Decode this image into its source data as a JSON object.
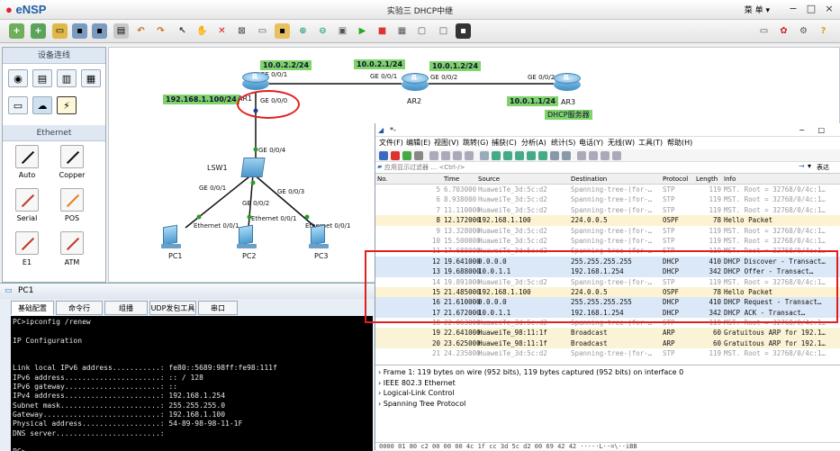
{
  "app": {
    "name": "eNSP",
    "window_title": "实验三 DHCP中继",
    "menu_label": "菜 单"
  },
  "device_panel": {
    "title": "设备连线",
    "section": "Ethernet",
    "cables": [
      {
        "label": "Auto",
        "color": "#111111"
      },
      {
        "label": "Copper",
        "color": "#111111"
      },
      {
        "label": "Serial",
        "color": "#c0392b"
      },
      {
        "label": "POS",
        "color": "#e67e22"
      },
      {
        "label": "E1",
        "color": "#c0392b"
      },
      {
        "label": "ATM",
        "color": "#c0392b"
      }
    ]
  },
  "topology": {
    "ips": [
      "10.0.2.2/24",
      "10.0.2.1/24",
      "10.0.1.2/24",
      "10.0.1.1/24",
      "192.168.1.100/24"
    ],
    "ports": {
      "ar1_ge001": "GE 0/0/1",
      "ar1_ge000": "GE 0/0/0",
      "ar2_ge001": "GE 0/0/1",
      "ar2_ge002": "GE 0/0/2",
      "ar3_ge002": "GE 0/0/2",
      "lsw_ge004": "GE 0/0/4",
      "lsw_ge001": "GE 0/0/1",
      "lsw_ge002": "GE 0/0/2",
      "lsw_ge003": "GE 0/0/3",
      "pc1_eth": "Ethernet 0/0/1",
      "pc2_eth": "Ethernet 0/0/1",
      "pc3_eth": "Ethernet 0/0/1"
    },
    "nodes": {
      "ar1": "AR1",
      "ar2": "AR2",
      "ar3": "AR3",
      "lsw1": "LSW1",
      "pc1": "PC1",
      "pc2": "PC2",
      "pc3": "PC3"
    },
    "server_label": "DHCP服务器"
  },
  "pc1_window": {
    "title": "PC1",
    "tabs": [
      "基础配置",
      "命令行",
      "组播",
      "UDP发包工具",
      "串口"
    ],
    "console": [
      "PC>ipconfig /renew",
      "",
      "IP Configuration",
      "",
      "",
      "Link local IPv6 address...........: fe80::5689:98ff:fe98:111f",
      "IPv6 address......................: :: / 128",
      "IPv6 gateway......................: ::",
      "IPv4 address......................: 192.168.1.254",
      "Subnet mask.......................: 255.255.255.0",
      "Gateway...........................: 192.168.1.100",
      "Physical address..................: 54-89-98-98-11-1F",
      "DNS server........................:",
      "",
      "PC>"
    ]
  },
  "wireshark": {
    "title": "*-",
    "menus": [
      "文件(F)",
      "编辑(E)",
      "视图(V)",
      "跳转(G)",
      "捕获(C)",
      "分析(A)",
      "统计(S)",
      "电话(Y)",
      "无线(W)",
      "工具(T)",
      "帮助(H)"
    ],
    "filter_placeholder": "应用显示过滤器 … <Ctrl-/>",
    "expression_label": "表达式…",
    "columns": {
      "no": "No.",
      "time": "Time",
      "source": "Source",
      "destination": "Destination",
      "protocol": "Protocol",
      "length": "Length",
      "info": "Info"
    },
    "packets": [
      {
        "kind": "stp",
        "no": "5",
        "time": "6.703000",
        "src": "HuaweiTe_3d:5c:d2",
        "dst": "Spanning-tree-(for-…",
        "proto": "STP",
        "len": "119",
        "info": "MST. Root = 32768/0/4c:1…"
      },
      {
        "kind": "stp",
        "no": "6",
        "time": "8.938000",
        "src": "HuaweiTe_3d:5c:d2",
        "dst": "Spanning-tree-(for-…",
        "proto": "STP",
        "len": "119",
        "info": "MST. Root = 32768/0/4c:1…"
      },
      {
        "kind": "stp",
        "no": "7",
        "time": "11.110000",
        "src": "HuaweiTe_3d:5c:d2",
        "dst": "Spanning-tree-(for-…",
        "proto": "STP",
        "len": "119",
        "info": "MST. Root = 32768/0/4c:1…"
      },
      {
        "kind": "ospf",
        "no": "8",
        "time": "12.172000",
        "src": "192.168.1.100",
        "dst": "224.0.0.5",
        "proto": "OSPF",
        "len": "78",
        "info": "Hello Packet"
      },
      {
        "kind": "stp",
        "no": "9",
        "time": "13.328000",
        "src": "HuaweiTe_3d:5c:d2",
        "dst": "Spanning-tree-(for-…",
        "proto": "STP",
        "len": "119",
        "info": "MST. Root = 32768/0/4c:1…"
      },
      {
        "kind": "stp",
        "no": "10",
        "time": "15.500000",
        "src": "HuaweiTe_3d:5c:d2",
        "dst": "Spanning-tree-(for-…",
        "proto": "STP",
        "len": "119",
        "info": "MST. Root = 32768/0/4c:1…"
      },
      {
        "kind": "stp",
        "no": "11",
        "time": "17.688000",
        "src": "HuaweiTe_3d:5c:d2",
        "dst": "Spanning-tree-(for-…",
        "proto": "STP",
        "len": "119",
        "info": "MST. Root = 32768/0/4c:1…"
      },
      {
        "kind": "dhcp",
        "no": "12",
        "time": "19.641000",
        "src": "0.0.0.0",
        "dst": "255.255.255.255",
        "proto": "DHCP",
        "len": "410",
        "info": "DHCP Discover - Transact…"
      },
      {
        "kind": "dhcp",
        "no": "13",
        "time": "19.688000",
        "src": "10.0.1.1",
        "dst": "192.168.1.254",
        "proto": "DHCP",
        "len": "342",
        "info": "DHCP Offer    - Transact…"
      },
      {
        "kind": "stp",
        "no": "14",
        "time": "19.891000",
        "src": "HuaweiTe_3d:5c:d2",
        "dst": "Spanning-tree-(for-…",
        "proto": "STP",
        "len": "119",
        "info": "MST. Root = 32768/0/4c:1…"
      },
      {
        "kind": "ospf",
        "no": "15",
        "time": "21.485000",
        "src": "192.168.1.100",
        "dst": "224.0.0.5",
        "proto": "OSPF",
        "len": "78",
        "info": "Hello Packet"
      },
      {
        "kind": "dhcp",
        "no": "16",
        "time": "21.610000",
        "src": "0.0.0.0",
        "dst": "255.255.255.255",
        "proto": "DHCP",
        "len": "410",
        "info": "DHCP Request  - Transact…"
      },
      {
        "kind": "dhcp",
        "no": "17",
        "time": "21.672000",
        "src": "10.0.1.1",
        "dst": "192.168.1.254",
        "proto": "DHCP",
        "len": "342",
        "info": "DHCP ACK      - Transact…"
      },
      {
        "kind": "stp",
        "no": "18",
        "time": "22.063000",
        "src": "HuaweiTe_3d:5c:d2",
        "dst": "Spanning-tree-(for-…",
        "proto": "STP",
        "len": "119",
        "info": "MST. Root = 32768/0/4c:1…"
      },
      {
        "kind": "arp",
        "no": "19",
        "time": "22.641000",
        "src": "HuaweiTe_98:11:1f",
        "dst": "Broadcast",
        "proto": "ARP",
        "len": "60",
        "info": "Gratuitous ARP for 192.1…"
      },
      {
        "kind": "arp",
        "no": "20",
        "time": "23.625000",
        "src": "HuaweiTe_98:11:1f",
        "dst": "Broadcast",
        "proto": "ARP",
        "len": "60",
        "info": "Gratuitous ARP for 192.1…"
      },
      {
        "kind": "stp",
        "no": "21",
        "time": "24.235000",
        "src": "HuaweiTe_3d:5c:d2",
        "dst": "Spanning-tree-(for-…",
        "proto": "STP",
        "len": "119",
        "info": "MST. Root = 32768/0/4c:1…"
      }
    ],
    "details": [
      "Frame 1: 119 bytes on wire (952 bits), 119 bytes captured (952 bits) on interface 0",
      "IEEE 802.3 Ethernet",
      "Logical-Link Control",
      "Spanning Tree Protocol"
    ],
    "bytes_line": "0000  01 80 c2 00 00 00 4c 1f cc 3d 5c d2 00 69 42 42   ·····L··=\\··iBB"
  },
  "colors": {
    "highlight": "#e02020",
    "ip_label_bg": "#7ed36a",
    "dhcp_row": "#dbe8f8",
    "ospf_row": "#fdf2d2"
  }
}
